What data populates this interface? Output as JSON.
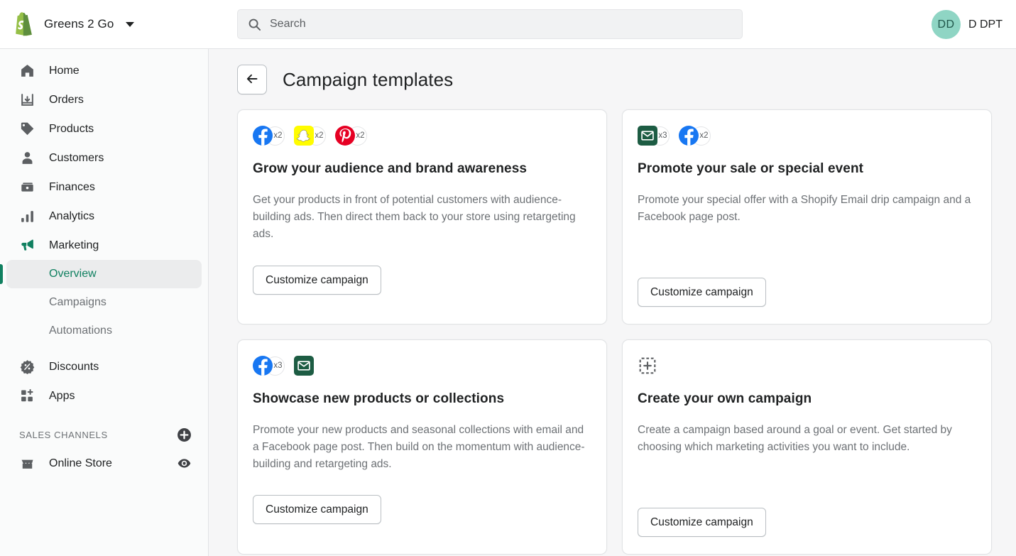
{
  "topbar": {
    "store_name": "Greens 2 Go",
    "logo_icon": "shopify-bag-logo",
    "store_caret_icon": "chevron-down-icon",
    "search": {
      "icon": "search-icon",
      "placeholder": "Search",
      "value": ""
    },
    "account": {
      "initials": "DD",
      "name": "D DPT",
      "avatar_color": "#8fd5c4"
    }
  },
  "sidebar": {
    "items": [
      {
        "label": "Home",
        "icon": "home-icon"
      },
      {
        "label": "Orders",
        "icon": "orders-inbox-icon"
      },
      {
        "label": "Products",
        "icon": "product-tag-icon"
      },
      {
        "label": "Customers",
        "icon": "customer-person-icon"
      },
      {
        "label": "Finances",
        "icon": "finances-cash-icon"
      },
      {
        "label": "Analytics",
        "icon": "analytics-bar-chart-icon"
      },
      {
        "label": "Marketing",
        "icon": "marketing-megaphone-icon"
      }
    ],
    "subitems": [
      {
        "label": "Overview",
        "active": true
      },
      {
        "label": "Campaigns",
        "active": false
      },
      {
        "label": "Automations",
        "active": false
      }
    ],
    "items_after": [
      {
        "label": "Discounts",
        "icon": "discount-percent-icon"
      },
      {
        "label": "Apps",
        "icon": "apps-grid-plus-icon"
      }
    ],
    "sales_channels": {
      "heading": "SALES CHANNELS",
      "add_icon": "plus-circle-icon",
      "channels": [
        {
          "label": "Online Store",
          "icon": "online-store-icon",
          "action_icon": "eye-view-icon"
        }
      ]
    },
    "active_accent_color": "#108060"
  },
  "main": {
    "back_icon": "arrow-left-icon",
    "page_title": "Campaign templates",
    "cards": [
      {
        "id": "grow-audience",
        "channels": [
          {
            "name": "facebook-icon",
            "count": "x2"
          },
          {
            "name": "snapchat-icon",
            "count": "x2"
          },
          {
            "name": "pinterest-icon",
            "count": "x2"
          }
        ],
        "title": "Grow your audience and brand awareness",
        "body": "Get your products in front of potential customers with audience-building ads. Then direct them back to your store using retargeting ads.",
        "cta": "Customize campaign"
      },
      {
        "id": "promote-sale",
        "channels": [
          {
            "name": "email-icon",
            "count": "x3"
          },
          {
            "name": "facebook-icon",
            "count": "x2"
          }
        ],
        "title": "Promote your sale or special event",
        "body": "Promote your special offer with a Shopify Email drip campaign and a Facebook page post.",
        "cta": "Customize campaign"
      },
      {
        "id": "showcase-products",
        "channels": [
          {
            "name": "facebook-icon",
            "count": "x3"
          },
          {
            "name": "email-icon",
            "count": ""
          }
        ],
        "title": "Showcase new products or collections",
        "body": "Promote your new products and seasonal collections with email and a Facebook page post. Then build on the momentum with audience-building and retargeting ads.",
        "cta": "Customize campaign"
      },
      {
        "id": "create-own",
        "channels": [
          {
            "name": "add-placeholder-icon",
            "count": ""
          }
        ],
        "title": "Create your own campaign",
        "body": "Create a campaign based around a goal or event. Get started by choosing which marketing activities you want to include.",
        "cta": "Customize campaign"
      }
    ]
  }
}
